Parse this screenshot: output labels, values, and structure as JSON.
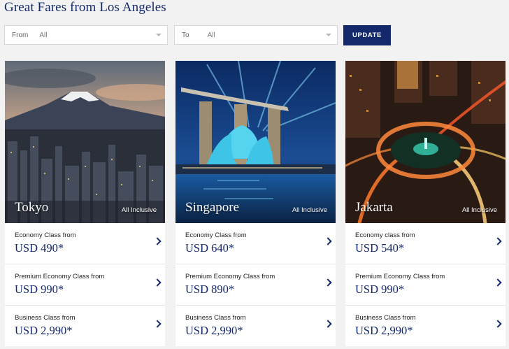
{
  "page": {
    "title": "Great Fares from Los Angeles"
  },
  "filters": {
    "from": {
      "label": "From",
      "value": "All"
    },
    "to": {
      "label": "To",
      "value": "All"
    },
    "update_label": "UPDATE"
  },
  "cards": [
    {
      "city": "Tokyo",
      "badge": "All Inclusive",
      "fares": [
        {
          "class_label": "Economy Class from",
          "price": "USD 490*"
        },
        {
          "class_label": "Premium Economy Class from",
          "price": "USD 990*"
        },
        {
          "class_label": "Business Class from",
          "price": "USD 2,990*"
        }
      ]
    },
    {
      "city": "Singapore",
      "badge": "All Inclusive",
      "fares": [
        {
          "class_label": "Economy Class from",
          "price": "USD 640*"
        },
        {
          "class_label": "Premium Economy Class from",
          "price": "USD 890*"
        },
        {
          "class_label": "Business Class from",
          "price": "USD 2,990*"
        }
      ]
    },
    {
      "city": "Jakarta",
      "badge": "All Inclusive",
      "fares": [
        {
          "class_label": "Economy class from",
          "price": "USD 540*"
        },
        {
          "class_label": "Premium Economy Class from",
          "price": "USD 990*"
        },
        {
          "class_label": "Business Class from",
          "price": "USD 2,990*"
        }
      ]
    }
  ],
  "colors": {
    "brand": "#14296b",
    "background": "#f2f2f2"
  }
}
